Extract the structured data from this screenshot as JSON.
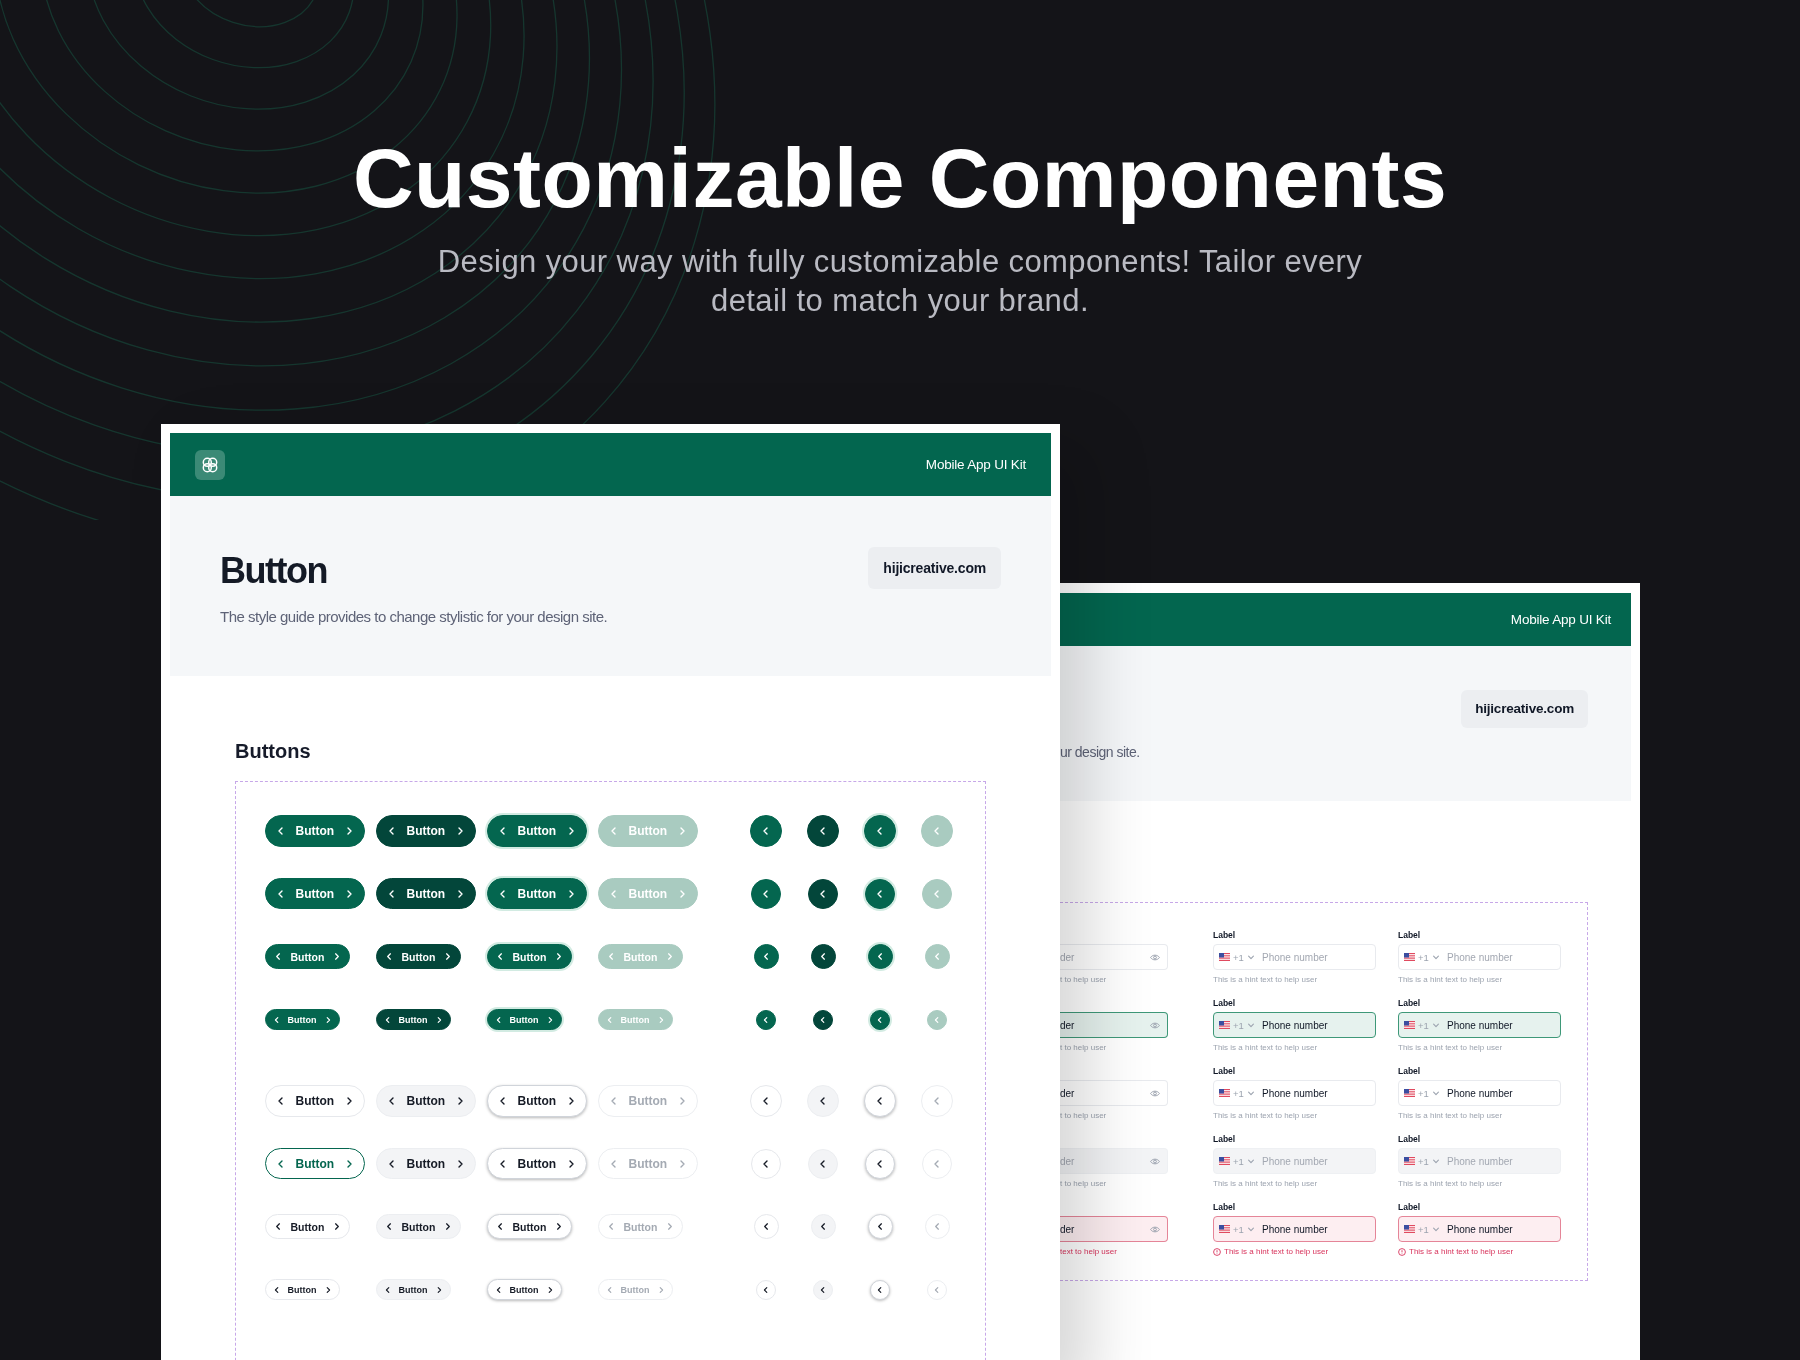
{
  "hero": {
    "title": "Customizable Components",
    "subtitle": "Design your way with fully customizable components! Tailor every detail to match your brand."
  },
  "front_card": {
    "header": {
      "title": "Mobile App UI Kit"
    },
    "page_title": "Button",
    "badge": "hijicreative.com",
    "description": "The style guide provides to change stylistic for your design site.",
    "section_title": "Buttons",
    "rows": [
      {
        "kind": "filled",
        "buttons": [
          {
            "label": "Button",
            "kind": "default"
          },
          {
            "label": "Button",
            "kind": "pressed"
          },
          {
            "label": "Button",
            "kind": "focused"
          },
          {
            "label": "Button",
            "kind": "disabled"
          }
        ],
        "icon_buttons": [
          {
            "kind": "default"
          },
          {
            "kind": "pressed"
          },
          {
            "kind": "focused"
          },
          {
            "kind": "disabled"
          }
        ]
      },
      {
        "kind": "filled",
        "buttons": [
          {
            "label": "Button",
            "kind": "default"
          },
          {
            "label": "Button",
            "kind": "pressed"
          },
          {
            "label": "Button",
            "kind": "focused"
          },
          {
            "label": "Button",
            "kind": "disabled"
          }
        ],
        "icon_buttons": [
          {
            "kind": "default"
          },
          {
            "kind": "pressed"
          },
          {
            "kind": "focused"
          },
          {
            "kind": "disabled"
          }
        ]
      },
      {
        "kind": "filled",
        "buttons": [
          {
            "label": "Button",
            "kind": "default"
          },
          {
            "label": "Button",
            "kind": "pressed"
          },
          {
            "label": "Button",
            "kind": "focused"
          },
          {
            "label": "Button",
            "kind": "disabled"
          }
        ],
        "icon_buttons": [
          {
            "kind": "default"
          },
          {
            "kind": "pressed"
          },
          {
            "kind": "focused"
          },
          {
            "kind": "disabled"
          }
        ]
      },
      {
        "kind": "filled",
        "buttons": [
          {
            "label": "Button",
            "kind": "default"
          },
          {
            "label": "Button",
            "kind": "pressed"
          },
          {
            "label": "Button",
            "kind": "focused"
          },
          {
            "label": "Button",
            "kind": "disabled"
          }
        ],
        "icon_buttons": [
          {
            "kind": "default"
          },
          {
            "kind": "pressed"
          },
          {
            "kind": "focused"
          },
          {
            "kind": "disabled"
          }
        ]
      },
      {
        "kind": "outline",
        "buttons": [
          {
            "label": "Button",
            "kind": "default"
          },
          {
            "label": "Button",
            "kind": "pressed"
          },
          {
            "label": "Button",
            "kind": "focused"
          },
          {
            "label": "Button",
            "kind": "disabled"
          }
        ],
        "icon_buttons": [
          {
            "kind": "default"
          },
          {
            "kind": "pressed"
          },
          {
            "kind": "focused"
          },
          {
            "kind": "disabled"
          }
        ]
      },
      {
        "kind": "outline",
        "buttons": [
          {
            "label": "Button",
            "kind": "active"
          },
          {
            "label": "Button",
            "kind": "pressed"
          },
          {
            "label": "Button",
            "kind": "focused"
          },
          {
            "label": "Button",
            "kind": "disabled"
          }
        ],
        "icon_buttons": [
          {
            "kind": "default"
          },
          {
            "kind": "pressed"
          },
          {
            "kind": "focused"
          },
          {
            "kind": "disabled"
          }
        ]
      },
      {
        "kind": "outline",
        "buttons": [
          {
            "label": "Button",
            "kind": "default"
          },
          {
            "label": "Button",
            "kind": "pressed"
          },
          {
            "label": "Button",
            "kind": "focused"
          },
          {
            "label": "Button",
            "kind": "disabled"
          }
        ],
        "icon_buttons": [
          {
            "kind": "default"
          },
          {
            "kind": "pressed"
          },
          {
            "kind": "focused"
          },
          {
            "kind": "disabled"
          }
        ]
      },
      {
        "kind": "outline",
        "buttons": [
          {
            "label": "Button",
            "kind": "default"
          },
          {
            "label": "Button",
            "kind": "pressed"
          },
          {
            "label": "Button",
            "kind": "focused"
          },
          {
            "label": "Button",
            "kind": "disabled"
          }
        ],
        "icon_buttons": [
          {
            "kind": "default"
          },
          {
            "kind": "pressed"
          },
          {
            "kind": "focused"
          },
          {
            "kind": "disabled"
          }
        ]
      }
    ]
  },
  "back_card": {
    "header": {
      "title": "Mobile App UI Kit"
    },
    "badge": "hijicreative.com",
    "description": "ur design site.",
    "columns": [
      {
        "kind": "password",
        "fields": [
          {
            "kind": "default",
            "placeholder": "der",
            "hint": "t to help user"
          },
          {
            "kind": "focused",
            "value": "der",
            "hint": "t to help user"
          },
          {
            "kind": "filled",
            "value": "der",
            "hint": "t to help user"
          },
          {
            "kind": "disabled",
            "placeholder": "der",
            "hint": "t to help user"
          },
          {
            "kind": "error",
            "value": "der",
            "hint": "text to help user"
          }
        ]
      },
      {
        "kind": "phone",
        "fields": [
          {
            "label": "Label",
            "kind": "default",
            "code": "+1",
            "placeholder": "Phone number",
            "hint": "This is a hint text to help user"
          },
          {
            "label": "Label",
            "kind": "focused",
            "code": "+1",
            "value": "Phone number",
            "hint": "This is a hint text to help user"
          },
          {
            "label": "Label",
            "kind": "filled",
            "code": "+1",
            "value": "Phone number",
            "hint": "This is a hint text to help user"
          },
          {
            "label": "Label",
            "kind": "disabled",
            "code": "+1",
            "placeholder": "Phone number",
            "hint": "This is a hint text to help user"
          },
          {
            "label": "Label",
            "kind": "error",
            "code": "+1",
            "value": "Phone number",
            "hint": "This is a hint text to help user"
          }
        ]
      },
      {
        "kind": "phone",
        "fields": [
          {
            "label": "Label",
            "kind": "default",
            "code": "+1",
            "placeholder": "Phone number",
            "hint": "This is a hint text to help user"
          },
          {
            "label": "Label",
            "kind": "focused",
            "code": "+1",
            "value": "Phone number",
            "hint": "This is a hint text to help user"
          },
          {
            "label": "Label",
            "kind": "filled",
            "code": "+1",
            "value": "Phone number",
            "hint": "This is a hint text to help user"
          },
          {
            "label": "Label",
            "kind": "disabled",
            "code": "+1",
            "placeholder": "Phone number",
            "hint": "This is a hint text to help user"
          },
          {
            "label": "Label",
            "kind": "error",
            "code": "+1",
            "value": "Phone number",
            "hint": "This is a hint text to help user"
          }
        ]
      }
    ]
  }
}
